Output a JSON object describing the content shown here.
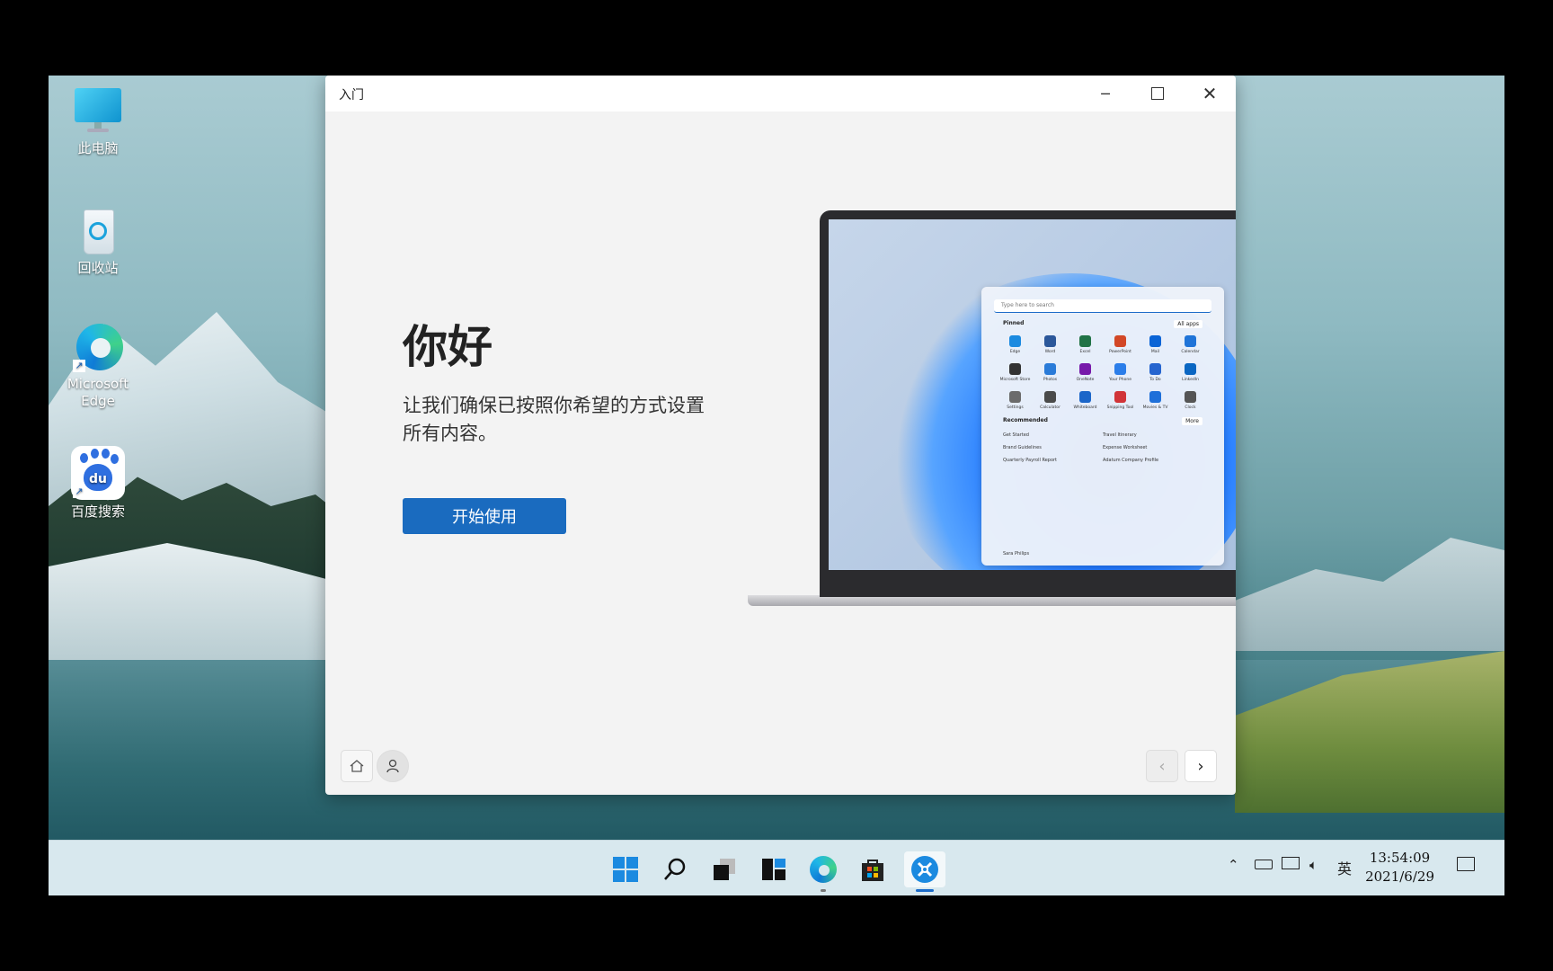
{
  "desktop": {
    "icons": [
      {
        "label": "此电脑"
      },
      {
        "label": "回收站"
      },
      {
        "label": "Microsoft Edge"
      },
      {
        "label": "百度搜索"
      }
    ]
  },
  "window": {
    "title": "入门",
    "greeting": "你好",
    "subtitle": "让我们确保已按照你希望的方式设置所有内容。",
    "start_button": "开始使用",
    "controls": [
      "minimize",
      "maximize",
      "close"
    ]
  },
  "laptop_screen": {
    "search_placeholder": "Type here to search",
    "pinned_label": "Pinned",
    "all_apps_label": "All apps",
    "pinned_apps": [
      {
        "name": "Edge",
        "color": "#1b8ae0"
      },
      {
        "name": "Word",
        "color": "#2b579a"
      },
      {
        "name": "Excel",
        "color": "#217346"
      },
      {
        "name": "PowerPoint",
        "color": "#d24726"
      },
      {
        "name": "Mail",
        "color": "#0a64d6"
      },
      {
        "name": "Calendar",
        "color": "#1f74d8"
      },
      {
        "name": "Microsoft Store",
        "color": "#333333"
      },
      {
        "name": "Photos",
        "color": "#2a7bd8"
      },
      {
        "name": "OneNote",
        "color": "#7719aa"
      },
      {
        "name": "Your Phone",
        "color": "#2b7de9"
      },
      {
        "name": "To Do",
        "color": "#2564cf"
      },
      {
        "name": "LinkedIn",
        "color": "#0a66c2"
      },
      {
        "name": "Settings",
        "color": "#6b6b6b"
      },
      {
        "name": "Calculator",
        "color": "#4a4a4a"
      },
      {
        "name": "Whiteboard",
        "color": "#1b66c9"
      },
      {
        "name": "Snipping Tool",
        "color": "#d13438"
      },
      {
        "name": "Movies & TV",
        "color": "#1e6fd9"
      },
      {
        "name": "Clock",
        "color": "#555555"
      }
    ],
    "recommended_label": "Recommended",
    "more_label": "More",
    "recommended": [
      "Get Started",
      "Travel Itinerary",
      "Brand Guidelines",
      "Expense Worksheet",
      "Quarterly Payroll Report",
      "Adatum Company Profile"
    ],
    "user": "Sara Philips"
  },
  "taskbar": {
    "apps": [
      "start-icon",
      "search-icon",
      "task-view-icon",
      "widgets-icon",
      "edge-icon",
      "store-icon",
      "get-started-icon"
    ],
    "tray_lang": "英",
    "time": "13:54:09",
    "date": "2021/6/29"
  },
  "colors": {
    "accent": "#1a6bbf"
  }
}
